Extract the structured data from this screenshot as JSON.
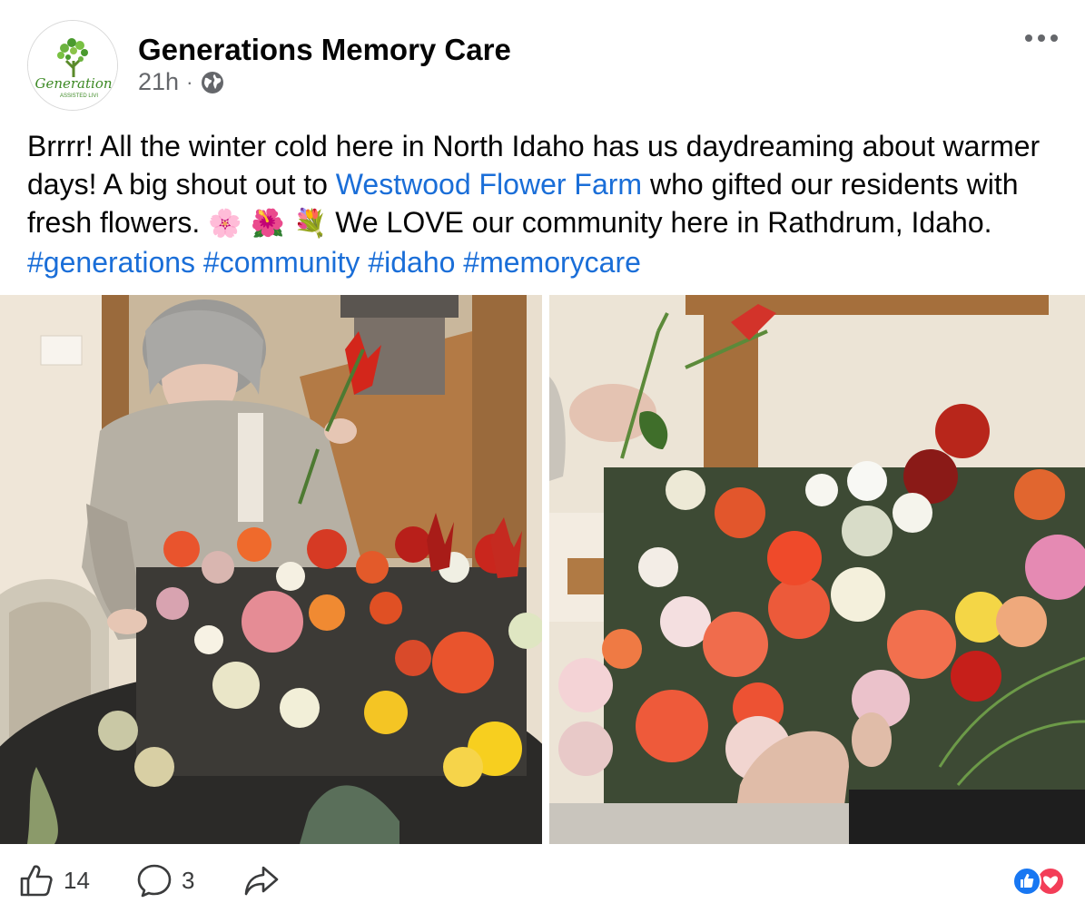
{
  "post": {
    "author": "Generations Memory Care",
    "time": "21h",
    "separator": "·",
    "avatar": {
      "logo_text": "Generation",
      "logo_subtext": "ASSISTED LIVI"
    },
    "caption": {
      "part1": "Brrrr! All the winter cold here in North Idaho has us daydreaming about warmer days! A big shout out to ",
      "link": "Westwood Flower Farm",
      "part2": "  who gifted our residents with fresh flowers. ",
      "emojis": "🌸 🌺 💐",
      "part3": "  We LOVE our community here in Rathdrum, Idaho. ",
      "hashtags": [
        "#generations",
        "#community",
        "#idaho",
        "#memorycare"
      ]
    }
  },
  "footer": {
    "likes": "14",
    "comments": "3"
  },
  "icons": {
    "more": "more-options-icon",
    "globe": "globe-icon",
    "like": "thumbs-up-icon",
    "comment": "comment-bubble-icon",
    "share": "share-arrow-icon",
    "reactions": "like-and-love-reactions-icon"
  },
  "colors": {
    "link": "#1a6ed8",
    "secondary_text": "#65676b",
    "like_blue": "#1877f2",
    "love_red": "#f33e58",
    "logo_green": "#4a9a2e"
  }
}
